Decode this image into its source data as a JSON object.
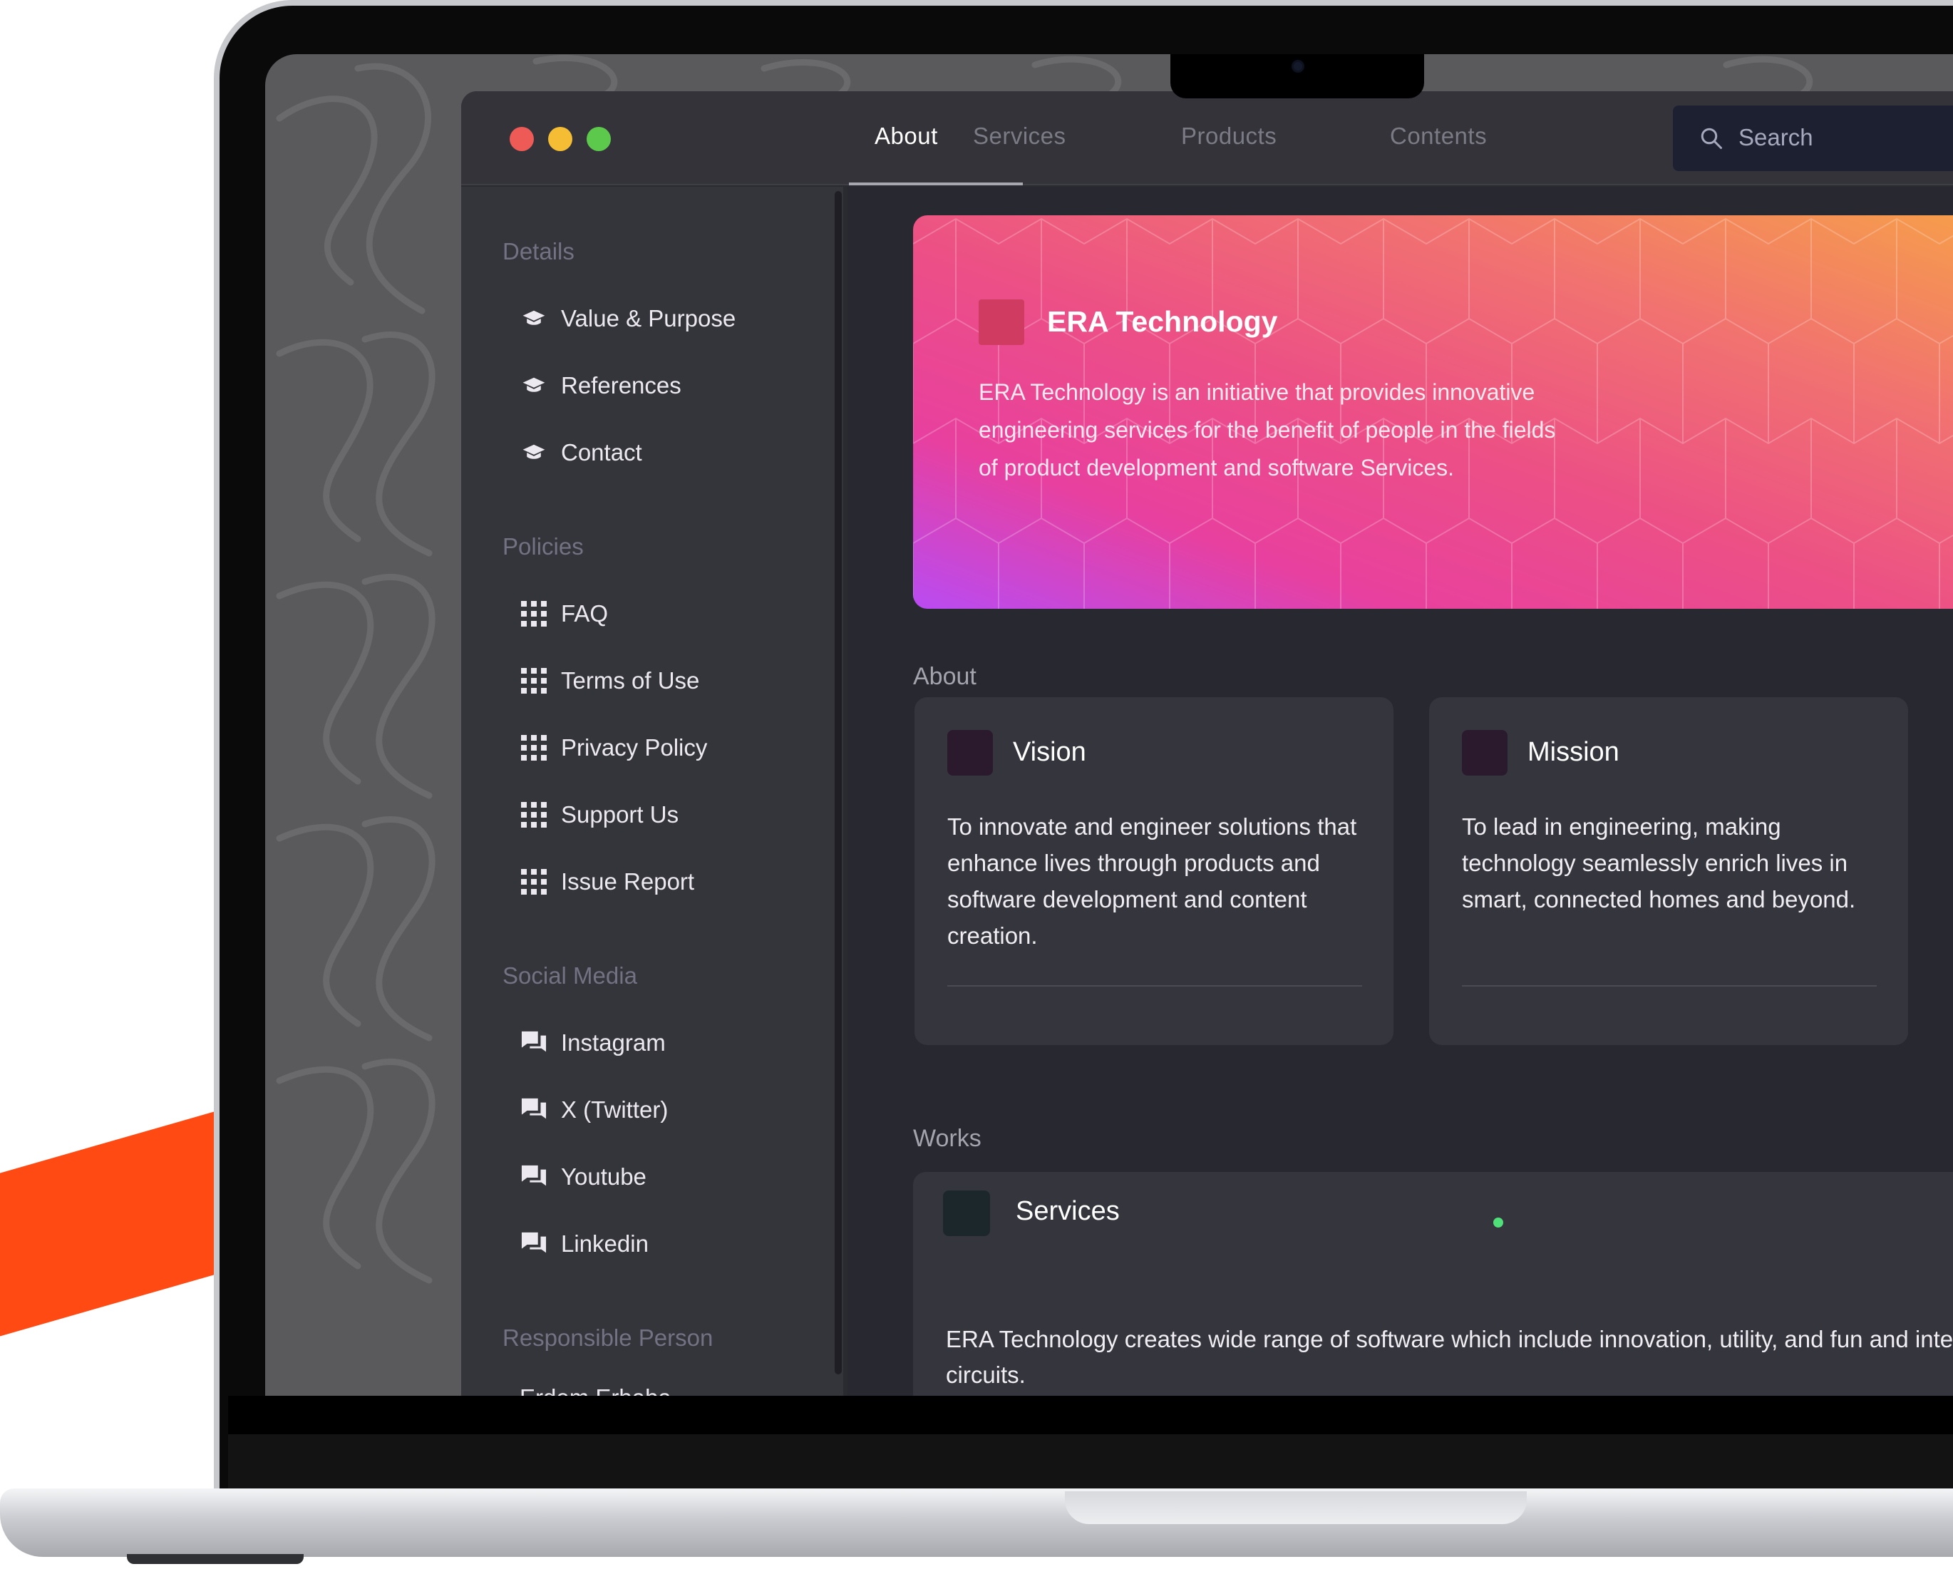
{
  "window": {
    "controls": [
      "close",
      "minimize",
      "maximize"
    ]
  },
  "nav": {
    "tabs": [
      {
        "label": "About",
        "active": true
      },
      {
        "label": "Services",
        "active": false
      },
      {
        "label": "Products",
        "active": false
      },
      {
        "label": "Contents",
        "active": false
      }
    ],
    "search_placeholder": "Search"
  },
  "sidebar": {
    "sections": [
      {
        "title": "Details",
        "icon": "graduation-cap-icon",
        "items": [
          "Value & Purpose",
          "References",
          "Contact"
        ]
      },
      {
        "title": "Policies",
        "icon": "grid-icon",
        "items": [
          "FAQ",
          "Terms of Use",
          "Privacy Policy",
          "Support Us",
          "Issue Report"
        ]
      },
      {
        "title": "Social Media",
        "icon": "chat-bubbles-icon",
        "items": [
          "Instagram",
          "X (Twitter)",
          "Youtube",
          "Linkedin"
        ]
      },
      {
        "title": "Responsible Person",
        "items": [
          "Erdem Erbaba"
        ]
      }
    ]
  },
  "hero": {
    "title": "ERA Technology",
    "description": "ERA Technology is an initiative that provides innovative engineering services for the benefit of people in the fields of product development and software Services."
  },
  "about": {
    "heading": "About",
    "cards": [
      {
        "title": "Vision",
        "text": "To innovate and engineer solutions that enhance lives through products and software development and content creation."
      },
      {
        "title": "Mission",
        "text": "To lead in engineering, making technology seamlessly enrich lives in smart, connected homes and beyond."
      }
    ]
  },
  "works": {
    "heading": "Works",
    "card": {
      "title": "Services",
      "text": "ERA Technology creates wide range of software which include innovation, utility, and fun and integrated circuits."
    }
  },
  "colors": {
    "accent_orange": "#ff4a14",
    "hero_gradient_start": "#b94bf2",
    "hero_gradient_end": "#f7a545",
    "status_dot": "#4fe07a"
  }
}
